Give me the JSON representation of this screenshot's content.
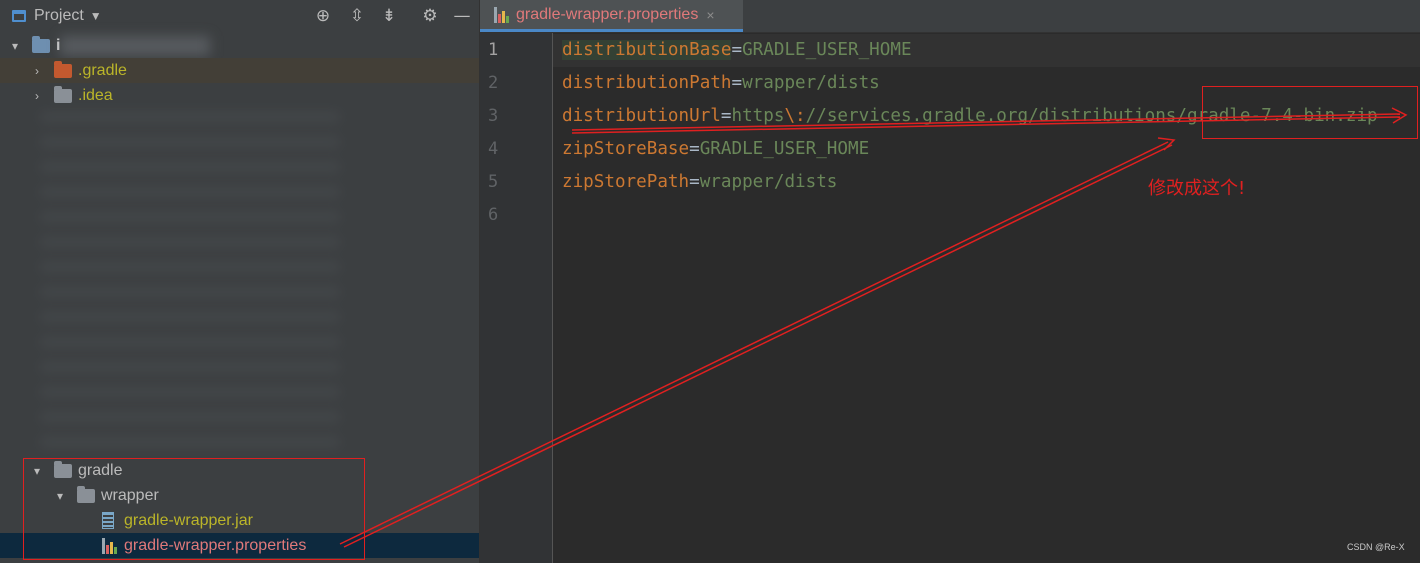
{
  "project_panel": {
    "title": "Project",
    "root_label": "i",
    "items": [
      {
        "label": ".gradle"
      },
      {
        "label": ".idea"
      },
      {
        "label": "gradle"
      },
      {
        "label": "wrapper"
      },
      {
        "label": "gradle-wrapper.jar"
      },
      {
        "label": "gradle-wrapper.properties"
      }
    ]
  },
  "editor": {
    "tab_label": "gradle-wrapper.properties",
    "tab_close": "×",
    "line_numbers": [
      "1",
      "2",
      "3",
      "4",
      "5",
      "6"
    ],
    "lines": [
      {
        "key": "distributionBase",
        "eq": "=",
        "value": "GRADLE_USER_HOME"
      },
      {
        "key": "distributionPath",
        "eq": "=",
        "value": "wrapper/dists"
      },
      {
        "key": "distributionUrl",
        "eq": "=",
        "value_prefix": "https",
        "esc": "\\:",
        "value": "//services.gradle.org/distributions/gradle-7.4-bin.zip"
      },
      {
        "key": "zipStoreBase",
        "eq": "=",
        "value": "GRADLE_USER_HOME"
      },
      {
        "key": "zipStorePath",
        "eq": "=",
        "value": "wrapper/dists"
      }
    ]
  },
  "annotation": {
    "text": "修改成这个!",
    "color": "#e02020"
  },
  "watermark": "CSDN @Re-X",
  "colors": {
    "accent": "#4a88c7",
    "key": "#cc7832",
    "value": "#6a8759",
    "annotation_red": "#e02020",
    "selected_row": "#0d293e"
  },
  "icons": [
    "window-icon",
    "locate-icon",
    "expand-all-icon",
    "collapse-all-icon",
    "gear-icon",
    "minimize-icon",
    "properties-file-icon",
    "jar-file-icon",
    "folder-icon"
  ]
}
